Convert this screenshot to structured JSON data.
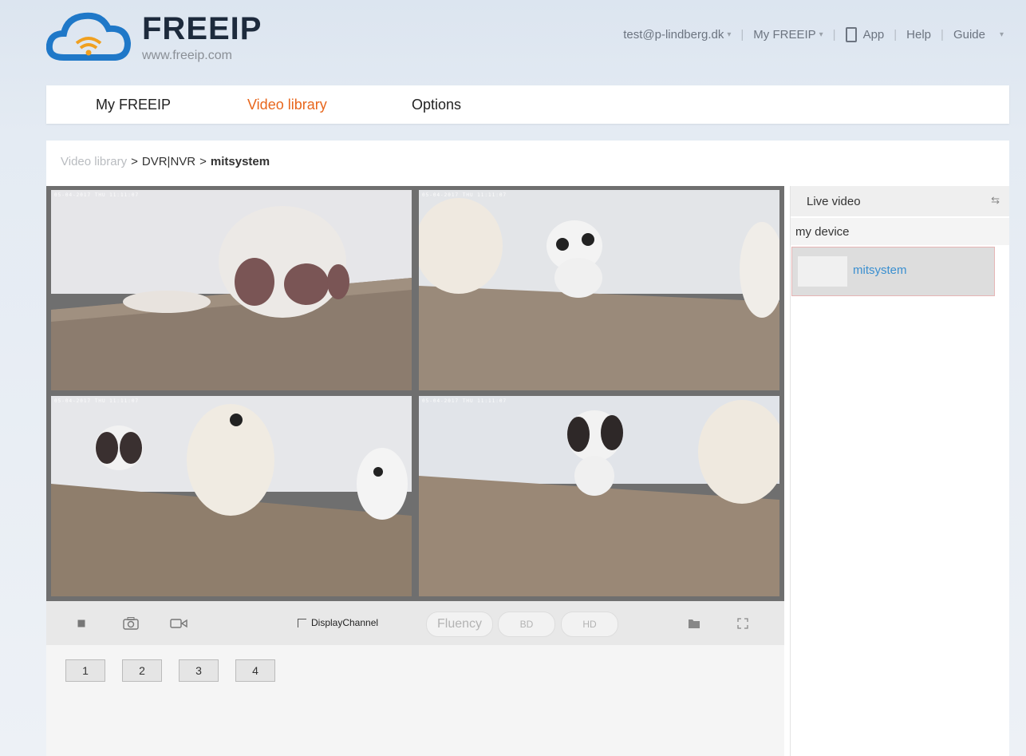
{
  "brand": {
    "name": "FREEIP",
    "url": "www.freeip.com"
  },
  "topnav": {
    "user": "test@p-lindberg.dk",
    "my_freeip": "My FREEIP",
    "app": "App",
    "help": "Help",
    "guide": "Guide"
  },
  "menu": {
    "items": [
      "My FREEIP",
      "Video library",
      "Options"
    ],
    "active": "Video library"
  },
  "breadcrumb": {
    "items": [
      "Video library",
      "DVR|NVR",
      "mitsystem"
    ],
    "separator": ">"
  },
  "video": {
    "tiles": [
      {
        "timestamp": "05-04-2017 THU 11:11:07"
      },
      {
        "timestamp": "05-04-2017 THU 11:11:07"
      },
      {
        "timestamp": "05-04-2017 THU 11:11:07"
      },
      {
        "timestamp": "05-04-2017 THU 11:11:07"
      }
    ]
  },
  "toolbar": {
    "display_channel": "DisplayChannel",
    "quality": [
      "Fluency",
      "BD",
      "HD"
    ],
    "icons": [
      "stop-icon",
      "snapshot-icon",
      "record-icon",
      "folder-icon",
      "fullscreen-icon"
    ]
  },
  "pages": [
    "1",
    "2",
    "3",
    "4"
  ],
  "side": {
    "title": "Live video",
    "group": "my device",
    "device": "mitsystem"
  },
  "colors": {
    "accent": "#e8661c",
    "link": "#3a8fd0"
  }
}
